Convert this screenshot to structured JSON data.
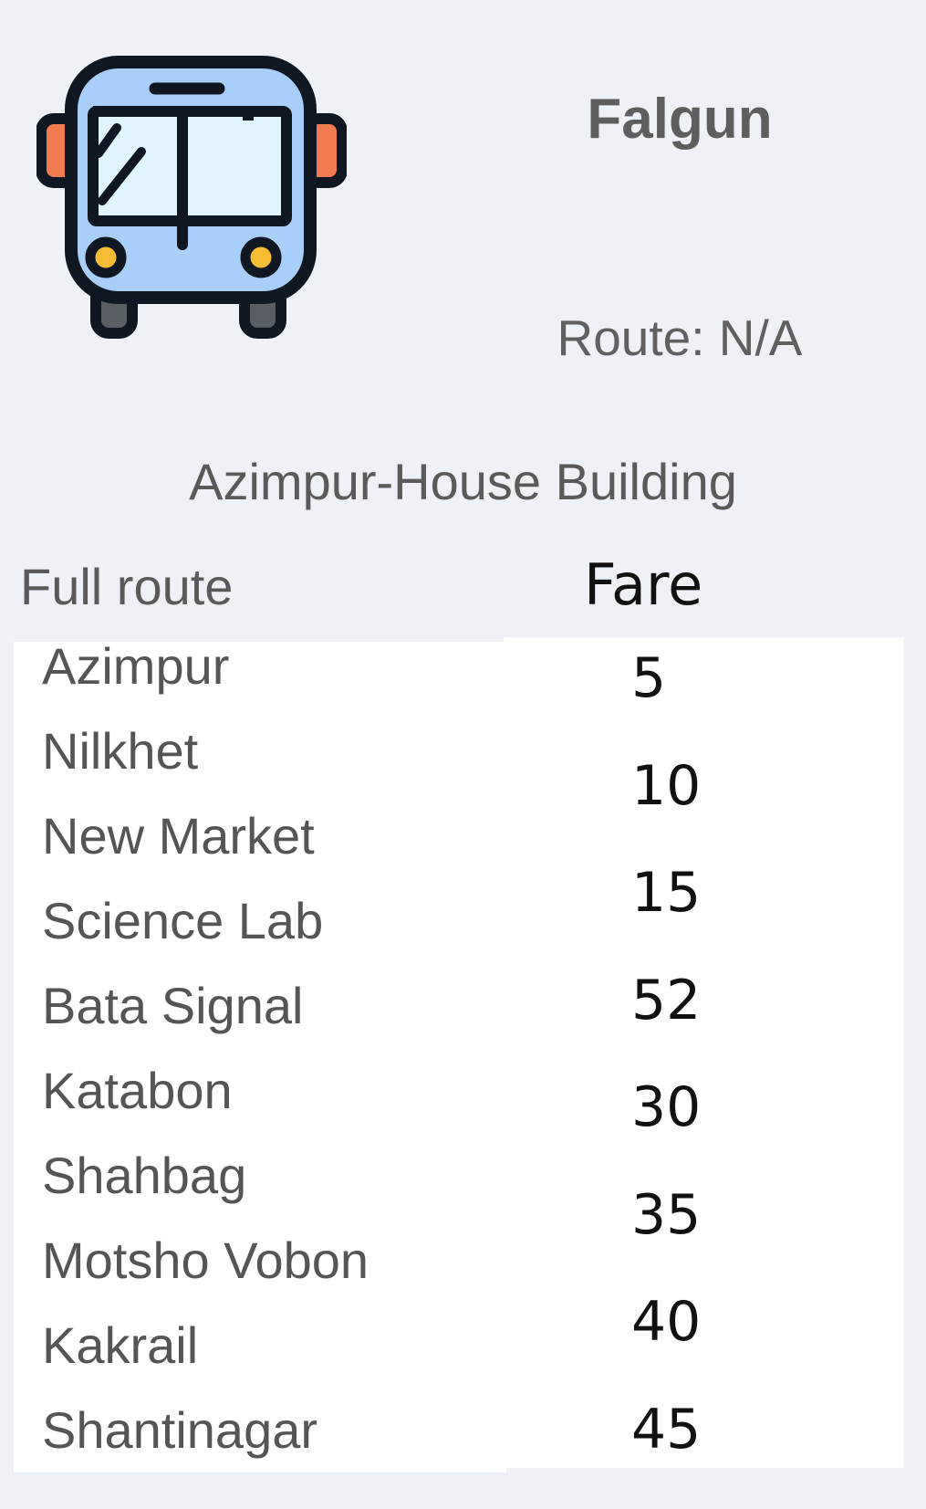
{
  "header": {
    "bus_name": "Falgun",
    "route": "Route: N/A",
    "route_endpoints": "Azimpur-House Building"
  },
  "table": {
    "route_header": "Full route",
    "fare_header": "Fare",
    "stops": [
      "Azimpur",
      "Nilkhet",
      "New Market",
      "Science Lab",
      "Bata Signal",
      "Katabon",
      "Shahbag",
      "Motsho Vobon",
      "Kakrail",
      "Shantinagar"
    ],
    "fares": [
      "5",
      "10",
      "15",
      "52",
      "30",
      "35",
      "40",
      "45"
    ]
  },
  "icons": {
    "bus": "bus-icon"
  },
  "colors": {
    "background": "#eef1f6",
    "bus_body": "#a7cffa",
    "bus_window": "#dff4fe",
    "bus_outline": "#0f1722",
    "mirror": "#f07b4f",
    "headlight": "#f5bc34"
  }
}
